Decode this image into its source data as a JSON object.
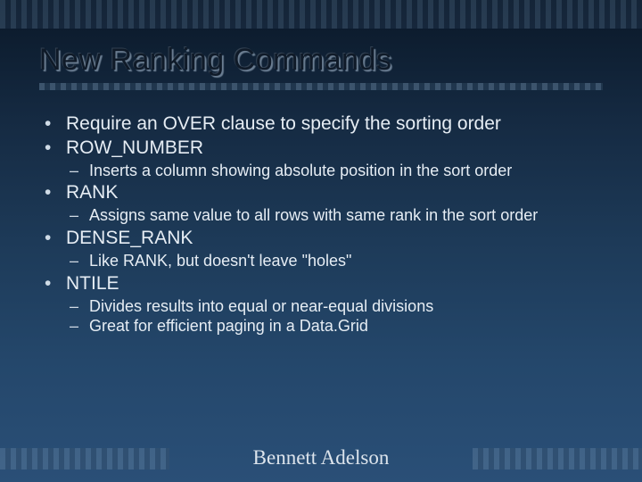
{
  "title": "New Ranking Commands",
  "bullets": {
    "b0": {
      "text": "Require an OVER clause to specify the sorting order"
    },
    "b1": {
      "text": "ROW_NUMBER",
      "sub": [
        "Inserts a column showing absolute position in the sort order"
      ]
    },
    "b2": {
      "text": "RANK",
      "sub": [
        "Assigns same value to all rows with same rank in the sort order"
      ]
    },
    "b3": {
      "text": "DENSE_RANK",
      "sub": [
        "Like RANK, but doesn't leave \"holes\""
      ]
    },
    "b4": {
      "text": "NTILE",
      "sub": [
        "Divides results into equal or near-equal divisions",
        "Great for efficient paging in a Data.Grid"
      ]
    }
  },
  "footer": "Bennett Adelson"
}
